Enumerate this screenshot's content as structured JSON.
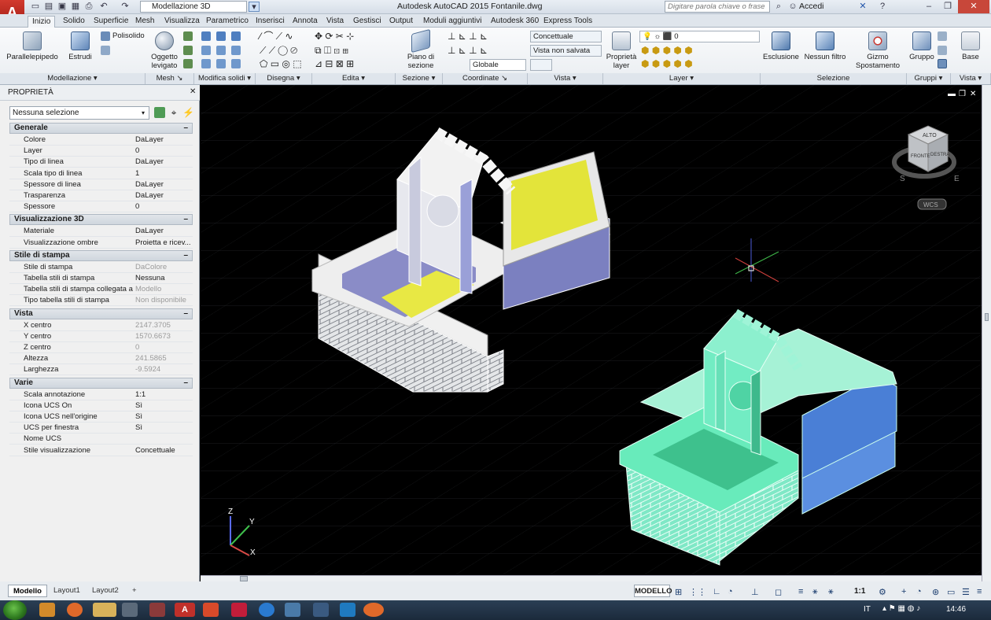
{
  "app": {
    "window_title": "Autodesk AutoCAD 2015    Fontanile.dwg",
    "app_letter": "A",
    "workspace": "Modellazione 3D",
    "search_placeholder": "Digitare parola chiave o frase",
    "login": "Accedi"
  },
  "tabs": [
    "Inizio",
    "Solido",
    "Superficie",
    "Mesh",
    "Visualizza",
    "Parametrico",
    "Inserisci",
    "Annota",
    "Vista",
    "Gestisci",
    "Output",
    "Moduli aggiuntivi",
    "Autodesk 360",
    "Express Tools"
  ],
  "ribbon": {
    "big": [
      {
        "label": "Parallelepipedo"
      },
      {
        "label": "Estrudi"
      },
      {
        "label": "Oggetto\nlevigato"
      },
      {
        "label": "Piano di\nsezione"
      },
      {
        "label": "Proprietà\nlayer"
      },
      {
        "label": "Esclusione"
      },
      {
        "label": "Nessun filtro"
      },
      {
        "label": "Gizmo\nSpostamento"
      },
      {
        "label": "Gruppo"
      },
      {
        "label": "Base"
      }
    ],
    "polisolido": "Polisolido",
    "panels": [
      {
        "label": "Modellazione"
      },
      {
        "label": "Mesh"
      },
      {
        "label": "Modifica solidi"
      },
      {
        "label": "Disegna"
      },
      {
        "label": "Edita"
      },
      {
        "label": "Sezione"
      },
      {
        "label": "Coordinate"
      },
      {
        "label": "Vista"
      },
      {
        "label": "Layer"
      },
      {
        "label": "Selezione"
      },
      {
        "label": "Gruppi"
      },
      {
        "label": "Vista"
      }
    ],
    "visual_style": "Concettuale",
    "view": "Vista non salvata",
    "ucs": "Globale",
    "layer": "0"
  },
  "properties": {
    "title": "PROPRIETÀ",
    "selection": "Nessuna selezione",
    "sections": [
      {
        "name": "Generale",
        "rows": [
          [
            "Colore",
            "DaLayer"
          ],
          [
            "Layer",
            "0"
          ],
          [
            "Tipo di linea",
            "DaLayer"
          ],
          [
            "Scala tipo di linea",
            "1"
          ],
          [
            "Spessore di linea",
            "DaLayer"
          ],
          [
            "Trasparenza",
            "DaLayer"
          ],
          [
            "Spessore",
            "0"
          ]
        ]
      },
      {
        "name": "Visualizzazione 3D",
        "rows": [
          [
            "Materiale",
            "DaLayer"
          ],
          [
            "Visualizzazione ombre",
            "Proietta  e  ricev..."
          ]
        ]
      },
      {
        "name": "Stile di stampa",
        "rows": [
          [
            "Stile di stampa",
            "DaColore"
          ],
          [
            "Tabella stili di stampa",
            "Nessuna"
          ],
          [
            "Tabella stili di stampa collegata a",
            "Modello"
          ],
          [
            "Tipo tabella stili di stampa",
            "Non disponibile"
          ]
        ]
      },
      {
        "name": "Vista",
        "rows": [
          [
            "X centro",
            "2147.3705"
          ],
          [
            "Y centro",
            "1570.6673"
          ],
          [
            "Z centro",
            "0"
          ],
          [
            "Altezza",
            "241.5865"
          ],
          [
            "Larghezza",
            "-9.5924"
          ]
        ]
      },
      {
        "name": "Varie",
        "rows": [
          [
            "Scala annotazione",
            "1:1"
          ],
          [
            "Icona UCS On",
            "Sì"
          ],
          [
            "Icona UCS nell'origine",
            "Sì"
          ],
          [
            "UCS per finestra",
            "Sì"
          ],
          [
            "Nome UCS",
            ""
          ],
          [
            "Stile visualizzazione",
            "Concettuale"
          ]
        ]
      }
    ]
  },
  "viewcube": {
    "top": "ALTO",
    "front": "FRONTE",
    "right": "DESTRA",
    "wcs": "WCS",
    "compass_s": "S",
    "compass_e": "E"
  },
  "ucs_labels": {
    "z": "Z",
    "y": "Y",
    "x": "X"
  },
  "layout_tabs": [
    "Modello",
    "Layout1",
    "Layout2"
  ],
  "status": {
    "model": "MODELLO",
    "scale": "1:1"
  },
  "taskbar": {
    "lang": "IT",
    "time": "14:46"
  },
  "colors": {
    "accent": "#c0302a",
    "fountain1_tint": "#d7dbe8",
    "fountain2_tint": "#5de3b4",
    "basin_yellow": "#e3e43a",
    "side_blue": "#4a7fd6"
  }
}
